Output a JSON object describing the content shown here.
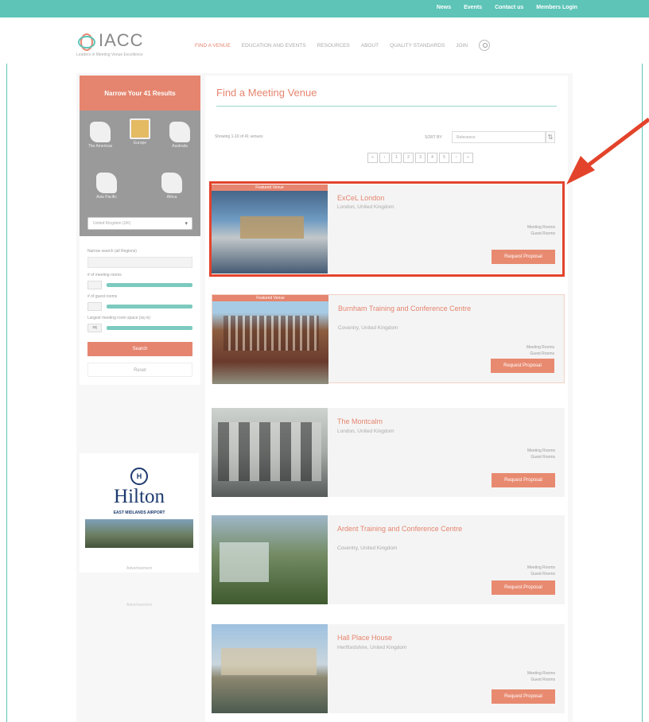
{
  "topbar": {
    "links": [
      "News",
      "Events",
      "Contact us",
      "Members Login"
    ]
  },
  "header": {
    "logo_text": "IACC",
    "logo_tagline": "Leaders in Meeting Venue Excellence",
    "nav": [
      {
        "label": "FIND A VENUE",
        "active": true
      },
      {
        "label": "EDUCATION AND EVENTS",
        "active": false
      },
      {
        "label": "RESOURCES",
        "active": false
      },
      {
        "label": "ABOUT",
        "active": false
      },
      {
        "label": "QUALITY STANDARDS",
        "active": false
      },
      {
        "label": "JOIN",
        "active": false
      }
    ]
  },
  "sidebar": {
    "heading": "Narrow Your 41 Results",
    "regions": [
      {
        "label": "The Americas",
        "selected": false
      },
      {
        "label": "Europe",
        "selected": true
      },
      {
        "label": "Australia",
        "selected": false
      },
      {
        "label": "Asia Pacific",
        "selected": false
      },
      {
        "label": "Africa",
        "selected": false
      }
    ],
    "region_select": "United Kingdom (UK)",
    "filters": {
      "location_label": "Narrow search (all Regions)",
      "meeting_rooms_label": "# of meeting rooms",
      "guest_rooms_label": "# of guest rooms",
      "largest_space_label": "Largest meeting room space (sq m)",
      "largest_space_value": "sq"
    },
    "search_label": "Search",
    "reset_label": "Reset"
  },
  "ad": {
    "logo_letter": "H",
    "name": "Hilton",
    "subtitle": "EAST MIDLANDS AIRPORT",
    "caption": "Advertisement",
    "caption2": "Advertisement"
  },
  "main": {
    "title": "Find a Meeting Venue",
    "result_count": "Showing 1-10 of 41 venues",
    "sort_label": "SORT BY",
    "sort_value": "Relevance",
    "pagination": [
      "«",
      "‹",
      "1",
      "2",
      "3",
      "4",
      "5",
      "›",
      "»"
    ],
    "venues": [
      {
        "tag": "Featured Venue",
        "name": "ExCeL London",
        "location": "London, United Kingdom",
        "description": "",
        "stats_meeting": "Meeting Rooms",
        "stats_guest": "Guest Rooms",
        "managed": "",
        "rating": "",
        "button": "Request Proposal"
      },
      {
        "tag": "Featured Venue",
        "name": "Burnham Training and Conference Centre",
        "location": "Coventry, United Kingdom",
        "description": "",
        "stats_meeting": "Meeting Rooms",
        "stats_guest": "Guest Rooms",
        "managed": "",
        "rating": "",
        "button": "Request Proposal"
      },
      {
        "tag": "",
        "name": "The Montcalm",
        "location": "London, United Kingdom",
        "description": "",
        "stats_meeting": "Meeting Rooms",
        "stats_guest": "Guest Rooms",
        "managed": "",
        "rating": "",
        "button": "Request Proposal"
      },
      {
        "tag": "",
        "name": "Ardent Training and Conference Centre",
        "location": "Coventry, United Kingdom",
        "description": "",
        "stats_meeting": "Meeting Rooms",
        "stats_guest": "Guest Rooms",
        "managed": "",
        "rating": "",
        "button": "Request Proposal"
      },
      {
        "tag": "",
        "name": "Hall Place House",
        "location": "Hertfordshire, United Kingdom",
        "description": "",
        "stats_meeting": "Meeting Rooms",
        "stats_guest": "Guest Rooms",
        "managed": "",
        "rating": "",
        "button": "Request Proposal"
      }
    ]
  },
  "colors": {
    "accent": "#e5856f",
    "teal": "#5dc4b7",
    "highlight": "#e3432b"
  }
}
